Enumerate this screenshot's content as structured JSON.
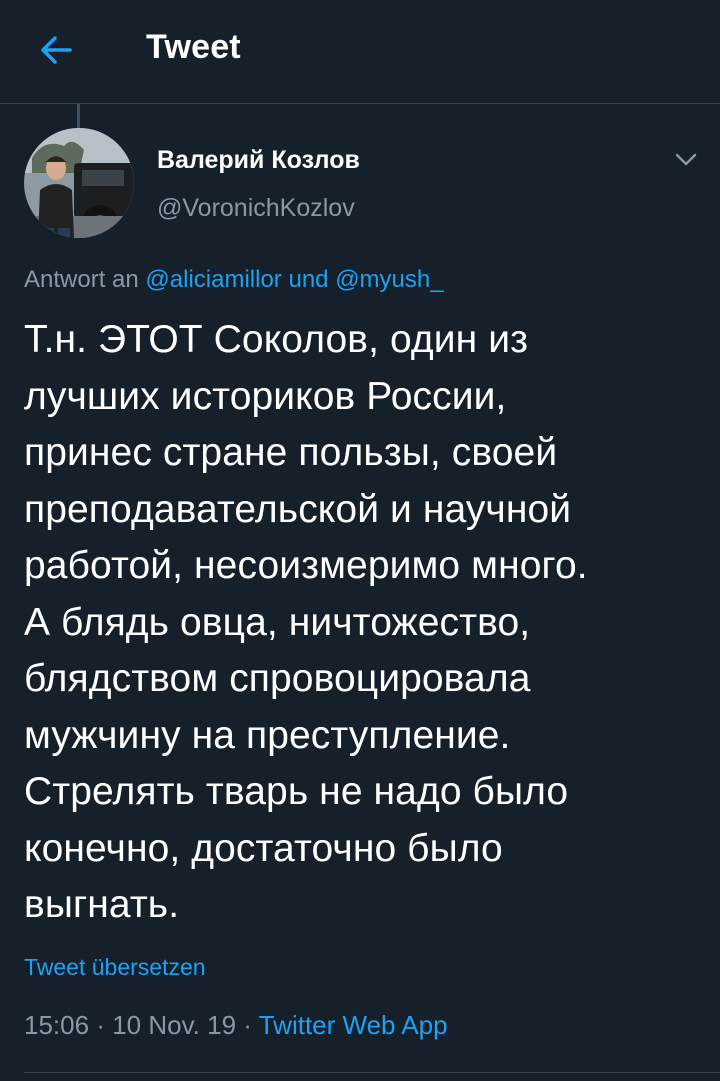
{
  "header": {
    "title": "Tweet",
    "back_icon": "arrow-left-icon"
  },
  "tweet": {
    "author_name": "Валерий Козлов",
    "author_handle": "@VoronichKozlov",
    "reply_prefix": "Antwort an",
    "reply_mention_1": "@aliciamillor",
    "reply_joiner": "und",
    "reply_mention_2": "@myush_",
    "text": "Т.н. ЭТОТ Соколов, один из\nлучших историков России,\nпринес стране пользы, своей\nпреподавательской и научной\nработой, несоизмеримо много.\nА блядь овца,  ничтожество,\nблядством спровоцировала\nмужчину на преступление.\nСтрелять тварь не надо было\nконечно, достаточно было\nвыгнать.",
    "translate_label": "Tweet übersetzen",
    "time": "15:06",
    "date": "10 Nov. 19",
    "separator": "·",
    "source": "Twitter Web App"
  },
  "colors": {
    "background": "#15202b",
    "accent": "#1da1f2",
    "secondary_text": "#8899a6",
    "divider": "#38444d"
  }
}
